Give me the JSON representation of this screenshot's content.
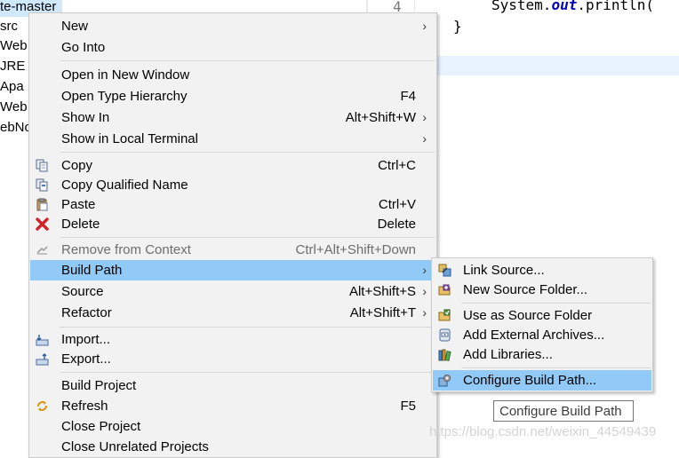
{
  "explorer": {
    "rows": [
      "te-master",
      "src",
      "Web",
      "JRE S",
      "Apa",
      "Web",
      "ebNo"
    ]
  },
  "editor": {
    "line_number": "4",
    "code_prefix": "System.",
    "code_keyword": "out",
    "code_suffix": ".println(",
    "closing_brace": "}"
  },
  "context_menu": {
    "items": [
      {
        "label": "New",
        "accel": "",
        "submenu": true
      },
      {
        "label": "Go Into",
        "accel": "",
        "submenu": false
      },
      {
        "label": "Open in New Window",
        "accel": "",
        "submenu": false
      },
      {
        "label": "Open Type Hierarchy",
        "accel": "F4",
        "submenu": false
      },
      {
        "label": "Show In",
        "accel": "Alt+Shift+W",
        "submenu": true
      },
      {
        "label": "Show in Local Terminal",
        "accel": "",
        "submenu": true
      },
      {
        "label": "Copy",
        "accel": "Ctrl+C",
        "icon": "copy-icon"
      },
      {
        "label": "Copy Qualified Name",
        "accel": "",
        "icon": "copy-qualified-name-icon"
      },
      {
        "label": "Paste",
        "accel": "Ctrl+V",
        "icon": "paste-icon"
      },
      {
        "label": "Delete",
        "accel": "Delete",
        "icon": "delete-icon"
      },
      {
        "label": "Remove from Context",
        "accel": "Ctrl+Alt+Shift+Down",
        "icon": "remove-from-context-icon",
        "disabled": true
      },
      {
        "label": "Build Path",
        "accel": "",
        "submenu": true,
        "highlighted": true
      },
      {
        "label": "Source",
        "accel": "Alt+Shift+S",
        "submenu": true
      },
      {
        "label": "Refactor",
        "accel": "Alt+Shift+T",
        "submenu": true
      },
      {
        "label": "Import...",
        "accel": "",
        "icon": "import-icon"
      },
      {
        "label": "Export...",
        "accel": "",
        "icon": "export-icon"
      },
      {
        "label": "Build Project",
        "accel": ""
      },
      {
        "label": "Refresh",
        "accel": "F5",
        "icon": "refresh-icon"
      },
      {
        "label": "Close Project",
        "accel": ""
      },
      {
        "label": "Close Unrelated Projects",
        "accel": ""
      }
    ],
    "submenu_arrow": "›"
  },
  "build_path_menu": {
    "items": [
      {
        "label": "Link Source...",
        "icon": "link-source-icon"
      },
      {
        "label": "New Source Folder...",
        "icon": "new-source-folder-icon"
      },
      {
        "label": "Use as Source Folder",
        "icon": "use-as-source-folder-icon"
      },
      {
        "label": "Add External Archives...",
        "icon": "add-external-archives-icon"
      },
      {
        "label": "Add Libraries...",
        "icon": "add-libraries-icon"
      },
      {
        "label": "Configure Build Path...",
        "icon": "configure-build-path-icon",
        "highlighted": true
      }
    ]
  },
  "tooltip": {
    "text": "Configure Build Path"
  },
  "watermark": {
    "text": "https://blog.csdn.net/weixin_44549439"
  },
  "colors": {
    "highlight": "#91c9f7",
    "menu_bg": "#f2f2f2",
    "keyword": "#0000c0"
  }
}
